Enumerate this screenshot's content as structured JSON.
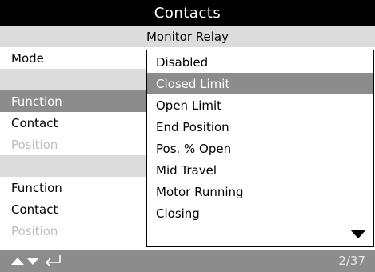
{
  "header": {
    "title": "Contacts"
  },
  "subheader": {
    "title": "Monitor Relay"
  },
  "left_panel": {
    "rows": [
      {
        "label": "Mode",
        "style": "normal"
      },
      {
        "label": "",
        "style": "gap"
      },
      {
        "label": "Function",
        "style": "selected"
      },
      {
        "label": "Contact",
        "style": "normal"
      },
      {
        "label": "Position",
        "style": "dim"
      },
      {
        "label": "",
        "style": "gap"
      },
      {
        "label": "Function",
        "style": "normal"
      },
      {
        "label": "Contact",
        "style": "normal"
      },
      {
        "label": "Position",
        "style": "dim"
      }
    ]
  },
  "dropdown": {
    "selected": "Closed Limit",
    "options": [
      "Disabled",
      "Closed Limit",
      "Open Limit",
      "End Position",
      "Pos. % Open",
      "Mid Travel",
      "Motor Running",
      "Closing"
    ],
    "more_icon": "triangle-down-icon"
  },
  "footer": {
    "icons": [
      "up-arrow-icon",
      "down-arrow-icon",
      "enter-icon"
    ],
    "page_indicator": "2/37"
  },
  "colors": {
    "background": "#000000",
    "panel": "#ffffff",
    "band": "#dcdcdc",
    "highlight": "#8c8c8c",
    "dim_text": "#bdbdbd"
  }
}
